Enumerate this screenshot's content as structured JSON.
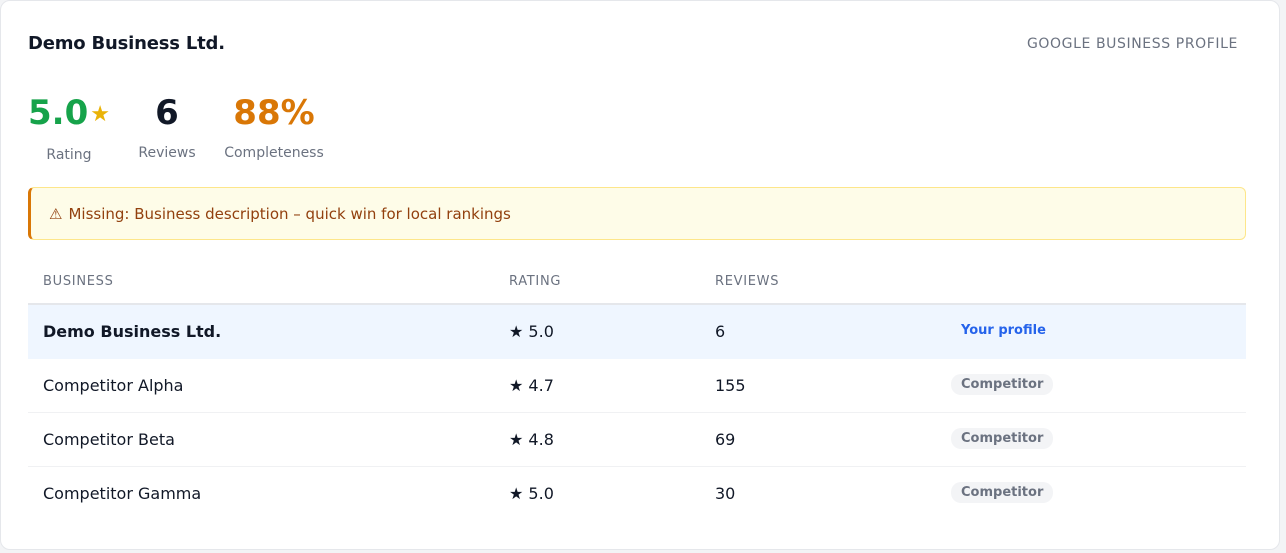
{
  "header": {
    "business_name": "Demo Business Ltd.",
    "source_label": "GOOGLE BUSINESS PROFILE"
  },
  "stats": {
    "rating": {
      "value": "5.0",
      "label": "Rating",
      "icon": "star-icon"
    },
    "reviews": {
      "value": "6",
      "label": "Reviews"
    },
    "completeness": {
      "value": "88%",
      "label": "Completeness"
    }
  },
  "alert": {
    "icon": "warning-icon",
    "text": "Missing: Business description – quick win for local rankings"
  },
  "table": {
    "headers": {
      "business": "BUSINESS",
      "rating": "RATING",
      "reviews": "REVIEWS"
    },
    "rows": [
      {
        "name": "Demo Business Ltd.",
        "rating": "★ 5.0",
        "reviews": "6",
        "tag": "Your profile"
      },
      {
        "name": "Competitor Alpha",
        "rating": "★ 4.7",
        "reviews": "155",
        "tag": "Competitor"
      },
      {
        "name": "Competitor Beta",
        "rating": "★ 4.8",
        "reviews": "69",
        "tag": "Competitor"
      },
      {
        "name": "Competitor Gamma",
        "rating": "★ 5.0",
        "reviews": "30",
        "tag": "Competitor"
      }
    ]
  },
  "colors": {
    "rating_green": "#16a34a",
    "completeness_amber": "#d97706",
    "star_yellow": "#eab308",
    "alert_bg": "#fefce8",
    "own_row_bg": "#eff6ff",
    "own_tag_blue": "#2563eb"
  }
}
